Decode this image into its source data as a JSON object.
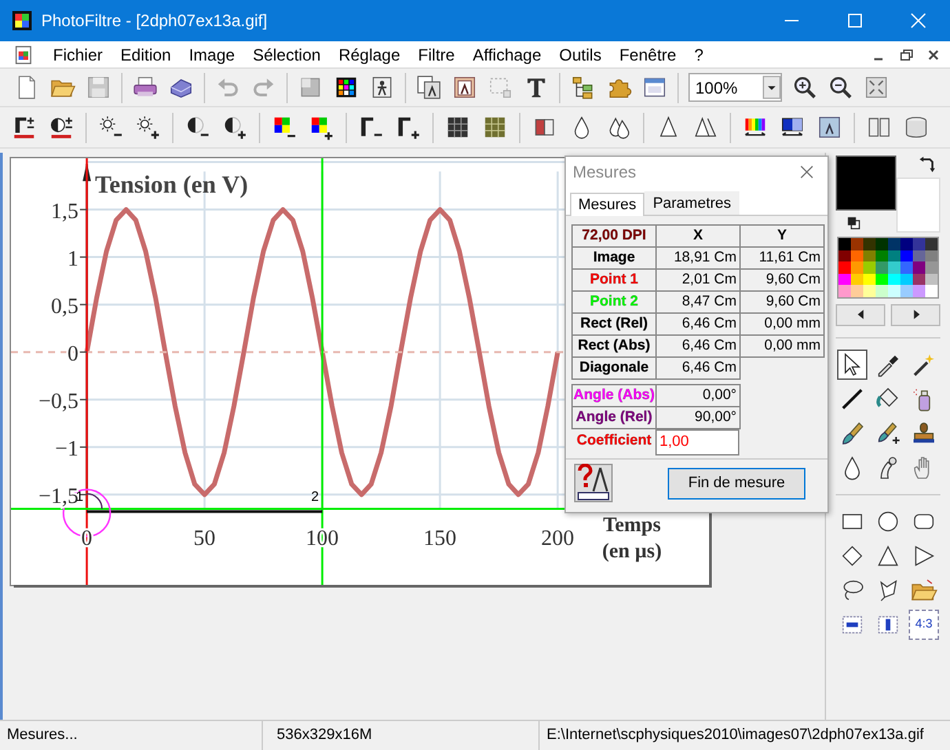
{
  "window": {
    "title": "PhotoFiltre - [2dph07ex13a.gif]"
  },
  "menu": [
    "Fichier",
    "Edition",
    "Image",
    "Sélection",
    "Réglage",
    "Filtre",
    "Affichage",
    "Outils",
    "Fenêtre",
    "?"
  ],
  "zoom": {
    "value": "100%"
  },
  "image": {
    "markers": [
      {
        "label": "1",
        "kind": "start"
      },
      {
        "label": "2",
        "kind": "end"
      }
    ],
    "chart_data": {
      "type": "line",
      "grid": true,
      "ref_lines": [
        {
          "axis": "y",
          "value": 0,
          "color": "#e8b8b0"
        },
        {
          "axis": "x",
          "value": 0,
          "color": "#ee1010"
        },
        {
          "axis": "x",
          "value": 100,
          "color": "#00ee00"
        }
      ],
      "xlabel": "Temps (en µs)",
      "ylabel": "Tension (en V)",
      "xlim": [
        -32.2,
        264.3
      ],
      "ylim": [
        -2.45,
        2.04
      ],
      "xticks": [
        0,
        50,
        100,
        150,
        200
      ],
      "yticks": [
        {
          "value": 1.5,
          "label": "1,5"
        },
        {
          "value": 1,
          "label": "1"
        },
        {
          "value": 0.5,
          "label": "0,5"
        },
        {
          "value": 0,
          "label": "0"
        },
        {
          "value": -0.5,
          "label": "−0,5"
        },
        {
          "value": -1,
          "label": "−1"
        },
        {
          "value": -1.5,
          "label": "−1,5"
        }
      ],
      "x": [
        0,
        4.2,
        8.3,
        12.5,
        16.7,
        20.8,
        25,
        29.2,
        33.3,
        37.5,
        41.7,
        45.8,
        50,
        54.2,
        58.3,
        62.5,
        66.7,
        70.8,
        75,
        79.2,
        83.3,
        87.5,
        91.7,
        95.8,
        100,
        104.2,
        108.3,
        112.5,
        116.7,
        120.8,
        125,
        129.2,
        133.3,
        137.5,
        141.7,
        145.8,
        150,
        154.2,
        158.3,
        162.5,
        166.7,
        170.8,
        175,
        179.2,
        183.3,
        187.5,
        191.7,
        195.8,
        200
      ],
      "series": [
        {
          "color": "#c86b6b",
          "values": [
            0,
            0.57,
            1.06,
            1.39,
            1.5,
            1.39,
            1.06,
            0.57,
            0,
            -0.57,
            -1.06,
            -1.39,
            -1.5,
            -1.39,
            -1.06,
            -0.57,
            0,
            0.57,
            1.06,
            1.39,
            1.5,
            1.39,
            1.06,
            0.57,
            0,
            -0.57,
            -1.06,
            -1.39,
            -1.5,
            -1.39,
            -1.06,
            -0.57,
            0,
            0.57,
            1.06,
            1.39,
            1.5,
            1.39,
            1.06,
            0.57,
            0,
            -0.57,
            -1.06,
            -1.39,
            -1.5,
            -1.39,
            -1.06,
            -0.57,
            0
          ]
        }
      ]
    }
  },
  "dialog": {
    "title": "Mesures",
    "tabs": [
      {
        "label": "Mesures",
        "selected": true
      },
      {
        "label": "Parametres",
        "selected": false
      }
    ],
    "header": {
      "label": "72,00 DPI",
      "color": "#800000",
      "x": "X",
      "y": "Y"
    },
    "rows": [
      {
        "label": "Image",
        "color": "#000000",
        "x": "18,91 Cm",
        "y": "11,61 Cm"
      },
      {
        "label": "Point 1",
        "color": "#ff0000",
        "x": "2,01 Cm",
        "y": "9,60 Cm"
      },
      {
        "label": "Point 2",
        "color": "#00ff00",
        "x": "8,47 Cm",
        "y": "9,60 Cm"
      },
      {
        "label": "Rect (Rel)",
        "color": "#000000",
        "x": "6,46 Cm",
        "y": "0,00 mm"
      },
      {
        "label": "Rect (Abs)",
        "color": "#000000",
        "x": "6,46 Cm",
        "y": "0,00 mm"
      },
      {
        "label": "Diagonale",
        "color": "#000000",
        "x": "6,46 Cm"
      }
    ],
    "angles": [
      {
        "label": "Angle (Abs)",
        "color": "#ff00ff",
        "value": "0,00°"
      },
      {
        "label": "Angle (Rel)",
        "color": "#800080",
        "value": "90,00°"
      }
    ],
    "coefficient": {
      "label": "Coefficient",
      "color": "#ff0000",
      "value": "1,00"
    },
    "button": "Fin de mesure"
  },
  "colors": {
    "foreground": {
      "color": "#000000"
    },
    "background": {
      "color": "#ffffff"
    },
    "palette": [
      {
        "color": "#000000"
      },
      {
        "color": "#993300"
      },
      {
        "color": "#333300"
      },
      {
        "color": "#003300"
      },
      {
        "color": "#003366"
      },
      {
        "color": "#000080"
      },
      {
        "color": "#333399"
      },
      {
        "color": "#333333"
      },
      {
        "color": "#800000"
      },
      {
        "color": "#ff6600"
      },
      {
        "color": "#808000"
      },
      {
        "color": "#008000"
      },
      {
        "color": "#008080"
      },
      {
        "color": "#0000ff"
      },
      {
        "color": "#666699"
      },
      {
        "color": "#808080"
      },
      {
        "color": "#ff0000"
      },
      {
        "color": "#ff9900"
      },
      {
        "color": "#99cc00"
      },
      {
        "color": "#339966"
      },
      {
        "color": "#33cccc"
      },
      {
        "color": "#3366ff"
      },
      {
        "color": "#800080"
      },
      {
        "color": "#969696"
      },
      {
        "color": "#ff00ff"
      },
      {
        "color": "#ffcc00"
      },
      {
        "color": "#ffff00"
      },
      {
        "color": "#00ff00"
      },
      {
        "color": "#00ffff"
      },
      {
        "color": "#00ccff"
      },
      {
        "color": "#993366"
      },
      {
        "color": "#c0c0c0"
      },
      {
        "color": "#ff99cc"
      },
      {
        "color": "#ffcc99"
      },
      {
        "color": "#ffff99"
      },
      {
        "color": "#ccffcc"
      },
      {
        "color": "#ccffff"
      },
      {
        "color": "#99ccff"
      },
      {
        "color": "#cc99ff"
      },
      {
        "color": "#ffffff"
      }
    ]
  },
  "tools": [
    {
      "kind": "pointer",
      "selected": true
    },
    {
      "kind": "eyedropper",
      "selected": false
    },
    {
      "kind": "wand",
      "selected": false
    },
    {
      "kind": "line",
      "selected": false
    },
    {
      "kind": "fill",
      "selected": false
    },
    {
      "kind": "spray",
      "selected": false
    },
    {
      "kind": "brush",
      "selected": false
    },
    {
      "kind": "brushplus",
      "selected": false
    },
    {
      "kind": "stamp",
      "selected": false
    },
    {
      "kind": "drop",
      "selected": false
    },
    {
      "kind": "smudge",
      "selected": false
    },
    {
      "kind": "hand",
      "selected": false
    }
  ],
  "shapes": [
    {
      "kind": "rect",
      "selected": false
    },
    {
      "kind": "ellipse",
      "selected": false
    },
    {
      "kind": "roundrect",
      "selected": false
    },
    {
      "kind": "diamond",
      "selected": false
    },
    {
      "kind": "triangle",
      "selected": false
    },
    {
      "kind": "play",
      "selected": false
    },
    {
      "kind": "lasso",
      "selected": false
    },
    {
      "kind": "polylasso",
      "selected": false
    },
    {
      "kind": "openfolder",
      "selected": false
    },
    {
      "kind": "hbar",
      "selected": false
    },
    {
      "kind": "vbar",
      "selected": false
    },
    {
      "kind": "ratio",
      "selected": false,
      "label": "4:3"
    }
  ],
  "status_bar": [
    "Mesures...",
    "536x329x16M",
    "E:\\Internet\\scphysiques2010\\images07\\2dph07ex13a.gif"
  ]
}
